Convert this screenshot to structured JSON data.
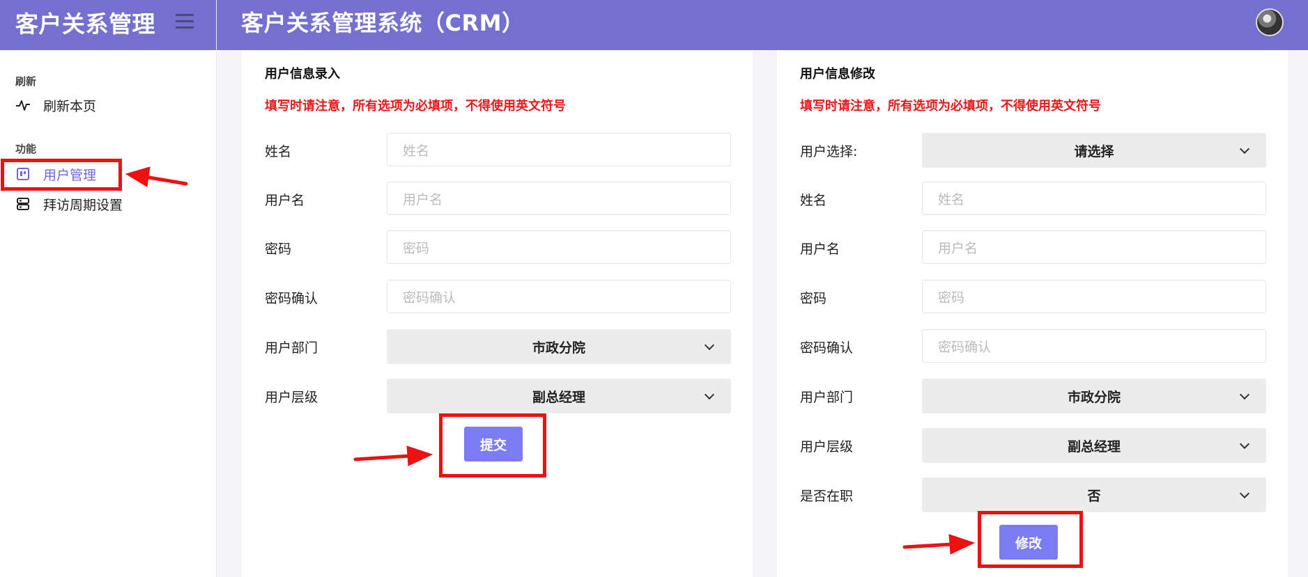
{
  "header": {
    "brand": "客户关系管理",
    "system_title": "客户关系管理系统（CRM）"
  },
  "sidebar": {
    "groups": [
      {
        "label": "刷新",
        "items": [
          {
            "label": "刷新本页",
            "icon": "pulse-icon"
          }
        ]
      },
      {
        "label": "功能",
        "items": [
          {
            "label": "用户管理",
            "icon": "board-icon",
            "active": true
          },
          {
            "label": "拜访周期设置",
            "icon": "server-icon"
          }
        ]
      }
    ]
  },
  "entry_form": {
    "title": "用户信息录入",
    "warning": "填写时请注意，所有选项为必填项，不得使用英文符号",
    "name_label": "姓名",
    "name_placeholder": "姓名",
    "username_label": "用户名",
    "username_placeholder": "用户名",
    "password_label": "密码",
    "password_placeholder": "密码",
    "confirm_label": "密码确认",
    "confirm_placeholder": "密码确认",
    "department_label": "用户部门",
    "department_value": "市政分院",
    "level_label": "用户层级",
    "level_value": "副总经理",
    "submit_label": "提交"
  },
  "edit_form": {
    "title": "用户信息修改",
    "warning": "填写时请注意，所有选项为必填项，不得使用英文符号",
    "user_select_label": "用户选择:",
    "user_select_value": "请选择",
    "name_label": "姓名",
    "name_placeholder": "姓名",
    "username_label": "用户名",
    "username_placeholder": "用户名",
    "password_label": "密码",
    "password_placeholder": "密码",
    "confirm_label": "密码确认",
    "confirm_placeholder": "密码确认",
    "department_label": "用户部门",
    "department_value": "市政分院",
    "level_label": "用户层级",
    "level_value": "副总经理",
    "employed_label": "是否在职",
    "employed_value": "否",
    "modify_label": "修改"
  },
  "colors": {
    "header": "#7470cf",
    "accent": "#7c7cf5",
    "warning": "#e8191b",
    "annotation": "#ee1111"
  }
}
